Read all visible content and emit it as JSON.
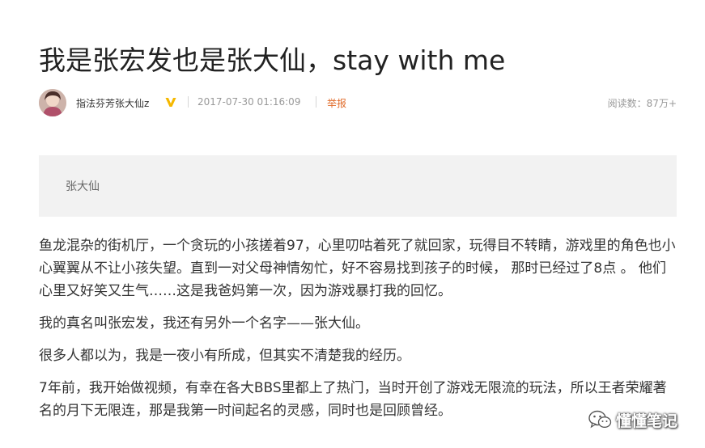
{
  "article": {
    "title": "我是张宏发也是张大仙，stay with me",
    "author": "指法芬芳张大仙z",
    "date": "2017-07-30 01:16:09",
    "report_label": "举报",
    "read_count": "阅读数：87万+",
    "summary": "张大仙",
    "paragraphs": [
      "鱼龙混杂的街机厅，一个贪玩的小孩搓着97，心里叨咕着死了就回家，玩得目不转睛，游戏里的角色也小心翼翼从不让小孩失望。直到一对父母神情匆忙，好不容易找到孩子的时候， 那时已经过了8点 。 他们心里又好笑又生气……这是我爸妈第一次，因为游戏暴打我的回忆。",
      "我的真名叫张宏发，我还有另外一个名字——张大仙。",
      "很多人都以为，我是一夜小有所成，但其实不清楚我的经历。",
      "7年前，我开始做视频，有幸在各大BBS里都上了热门，当时开创了游戏无限流的玩法，所以王者荣耀著名的月下无限连，那是我第一时间起名的灵感，同时也是回顾曾经。"
    ]
  },
  "watermark": {
    "text": "懂懂笔记",
    "icon": "wechat-icon"
  },
  "colors": {
    "report": "#e06b2a",
    "verified_badge": "#f5b800",
    "summary_bg": "#f2f2f2"
  }
}
